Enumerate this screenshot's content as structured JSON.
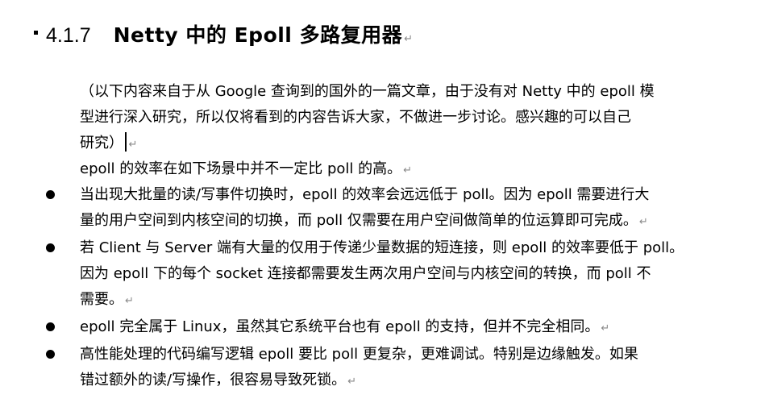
{
  "section": {
    "number": "4.1.7",
    "title": "Netty 中的 Epoll 多路复用器",
    "paragraph_mark": "↵"
  },
  "note": {
    "lines": [
      "（以下内容来自于从 Google 查询到的国外的一篇文章，由于没有对 Netty 中的 epoll 模",
      "型进行深入研究，所以仅将看到的内容告诉大家，不做进一步讨论。感兴趣的可以自己",
      "研究）"
    ]
  },
  "intro": "epoll 的效率在如下场景中并不一定比 poll 的高。",
  "bullets": [
    {
      "lines": [
        "当出现大批量的读/写事件切换时，epoll 的效率会远远低于 poll。因为 epoll 需要进行大",
        "量的用户空间到内核空间的切换，而 poll 仅需要在用户空间做简单的位运算即可完成。"
      ]
    },
    {
      "lines": [
        "若 Client 与 Server 端有大量的仅用于传递少量数据的短连接，则 epoll 的效率要低于 poll。",
        "因为 epoll 下的每个 socket 连接都需要发生两次用户空间与内核空间的转换，而 poll 不",
        "需要。"
      ]
    },
    {
      "lines": [
        "epoll 完全属于 Linux，虽然其它系统平台也有 epoll 的支持，但并不完全相同。"
      ]
    },
    {
      "lines": [
        "高性能处理的代码编写逻辑 epoll 要比 poll 更复杂，更难调试。特别是边缘触发。如果",
        "错过额外的读/写操作，很容易导致死锁。"
      ]
    }
  ]
}
